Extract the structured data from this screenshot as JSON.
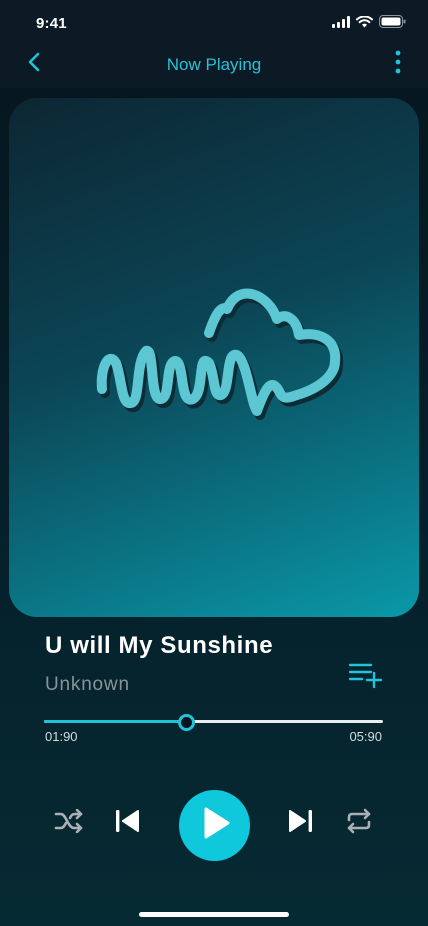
{
  "status_bar": {
    "time": "9:41"
  },
  "header": {
    "title": "Now Playing"
  },
  "track": {
    "title": "U will My Sunshine",
    "artist": "Unknown"
  },
  "progress": {
    "elapsed": "01:90",
    "total": "05:90",
    "fraction": 0.42
  },
  "colors": {
    "accent": "#22c2d8",
    "play_button": "#0fc8dc",
    "artwork_logo": "#5cc6d3",
    "secondary_text": "#8a9399"
  },
  "icons": {
    "back": "chevron-left-icon",
    "more": "more-vertical-icon",
    "queue": "playlist-add-icon",
    "shuffle": "shuffle-icon",
    "previous": "skip-previous-icon",
    "play": "play-icon",
    "next": "skip-next-icon",
    "repeat": "repeat-icon"
  }
}
